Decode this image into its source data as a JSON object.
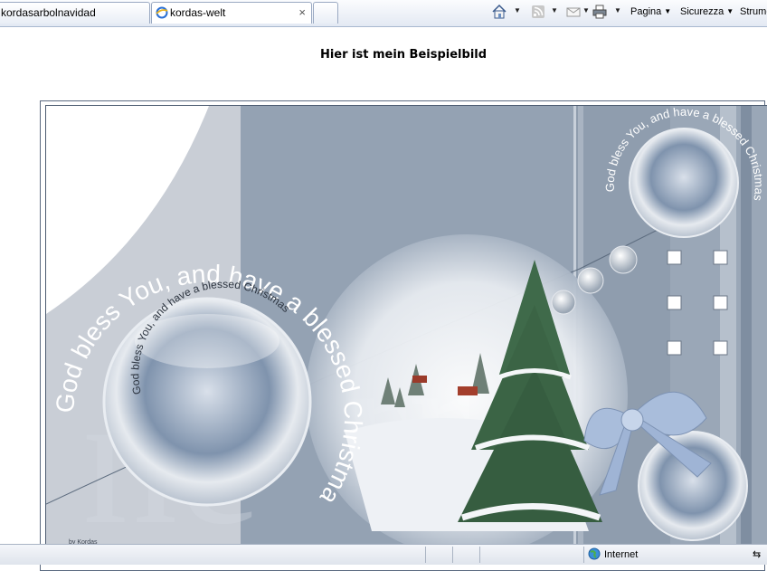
{
  "tabs": [
    {
      "label": "kordasarbolnavidad"
    },
    {
      "label": "kordas-welt",
      "close_symbol": "×"
    },
    {
      "label": ""
    }
  ],
  "command_bar": {
    "menu_pagina": "Pagina",
    "menu_sicurezza": "Sicurezza",
    "menu_strumenti": "Strume"
  },
  "page": {
    "title": "Hier ist mein Beispielbild"
  },
  "artwork": {
    "greeting_outer": "God bless You, and have a blessed Christmas",
    "greeting_inner": "God bless You, and have a blessed Christmas",
    "signature": "by Kordas"
  },
  "statusbar": {
    "zone_label": "Internet"
  },
  "colors": {
    "card_background": "#8d9cad",
    "accent": "#9eb6d8"
  }
}
